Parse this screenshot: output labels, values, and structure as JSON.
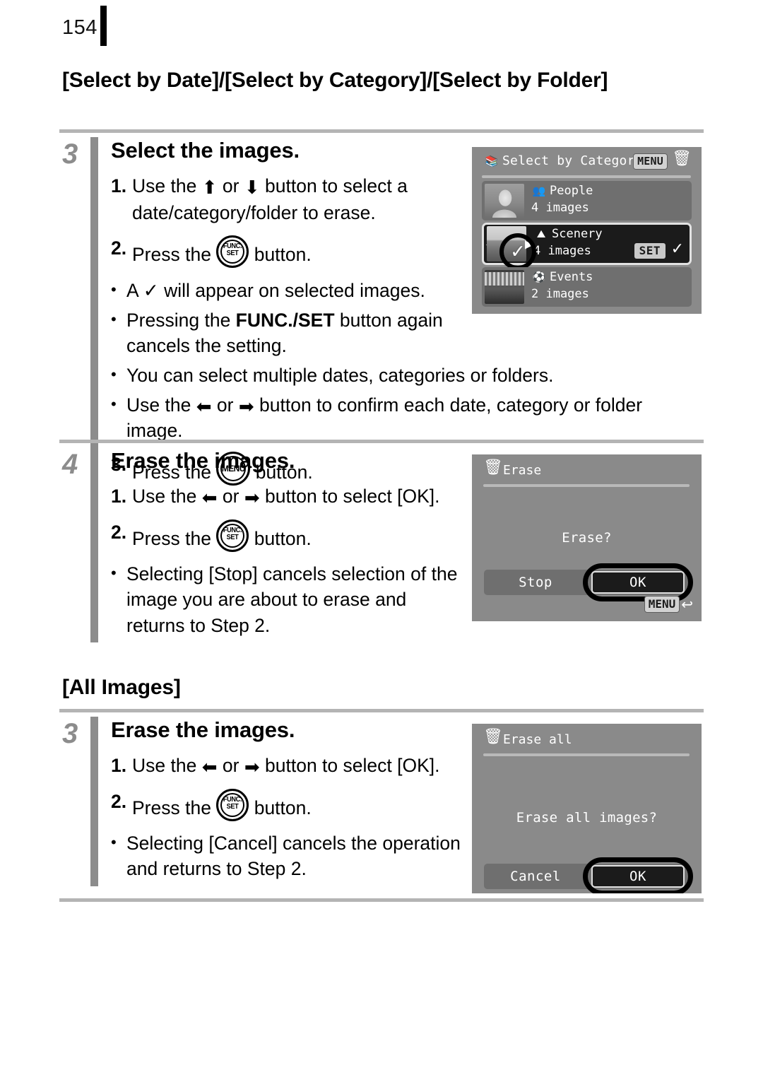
{
  "page": {
    "number": "154"
  },
  "headings": {
    "select_by": "[Select by Date]/[Select by Category]/[Select by Folder]",
    "all_images": "[All Images]"
  },
  "steps": [
    {
      "number": "3",
      "title": "Select the images.",
      "items": [
        {
          "marker": "1.",
          "text_before": "Use the",
          "arrow_a": "⬆",
          "mid": "or",
          "arrow_b": "⬇",
          "text_after": "button to select a date/category/folder to erase."
        },
        {
          "marker": "2.",
          "text_before": "Press the",
          "icon": "func-set-button",
          "text_after": "button."
        },
        {
          "marker": "•",
          "text": "A ✓ will appear on selected images."
        },
        {
          "marker": "•",
          "text_before": "Pressing the ",
          "bold": "FUNC./SET",
          "text_after": " button again cancels the setting."
        },
        {
          "marker": "•",
          "text": "You can select multiple dates, categories or folders."
        },
        {
          "marker": "•",
          "text_before": "Use the",
          "arrow_a": "⬅",
          "mid": "or",
          "arrow_b": "➡",
          "text_after": "button to confirm each date, category or folder image."
        },
        {
          "marker": "3.",
          "text_before": "Press the",
          "icon": "menu-button",
          "text_after": "button."
        }
      ]
    },
    {
      "number": "4",
      "title": "Erase the images.",
      "items": [
        {
          "marker": "1.",
          "text_before": "Use the",
          "arrow_a": "⬅",
          "mid": "or",
          "arrow_b": "➡",
          "text_after": "button to select [OK]."
        },
        {
          "marker": "2.",
          "text_before": "Press the",
          "icon": "func-set-button",
          "text_after": "button."
        },
        {
          "marker": "•",
          "text": "Selecting [Stop] cancels selection of the image you are about to erase and returns to Step 2."
        }
      ]
    },
    {
      "number": "3",
      "title": "Erase the images.",
      "items": [
        {
          "marker": "1.",
          "text_before": "Use the",
          "arrow_a": "⬅",
          "mid": "or",
          "arrow_b": "➡",
          "text_after": "button to select [OK]."
        },
        {
          "marker": "2.",
          "text_before": "Press the",
          "icon": "func-set-button",
          "text_after": "button."
        },
        {
          "marker": "•",
          "text": "Selecting [Cancel] cancels the operation and returns to Step 2."
        }
      ]
    }
  ],
  "lcd_category": {
    "title": "Select by Category",
    "menu_badge": "MENU",
    "rows": [
      {
        "name": "People",
        "count": "4 images",
        "icon": "people-category-icon",
        "selected": false
      },
      {
        "name": "Scenery",
        "count": "4 images",
        "icon": "scenery-category-icon",
        "selected": true,
        "set_badge": "SET",
        "check": "✓"
      },
      {
        "name": "Events",
        "count": "2 images",
        "icon": "events-category-icon",
        "selected": false
      }
    ]
  },
  "lcd_erase": {
    "title": "Erase",
    "message": "Erase?",
    "button_left": "Stop",
    "button_right": "OK",
    "menu_badge": "MENU"
  },
  "lcd_erase_all": {
    "title": "Erase all",
    "message": "Erase all images?",
    "button_left": "Cancel",
    "button_right": "OK"
  },
  "glyphs": {
    "up": "⬆",
    "down": "⬇",
    "left": "⬅",
    "right": "➡",
    "check": "✓",
    "trash": "🗑",
    "return": "↩"
  },
  "colors": {
    "rule": "#b4b4b4",
    "step_number": "#8c8c8c",
    "lcd_background": "#8a8a8a",
    "lcd_row": "#6f6f6f",
    "lcd_selected_row": "#1b1b1b",
    "badge": "#d2d2d2"
  }
}
